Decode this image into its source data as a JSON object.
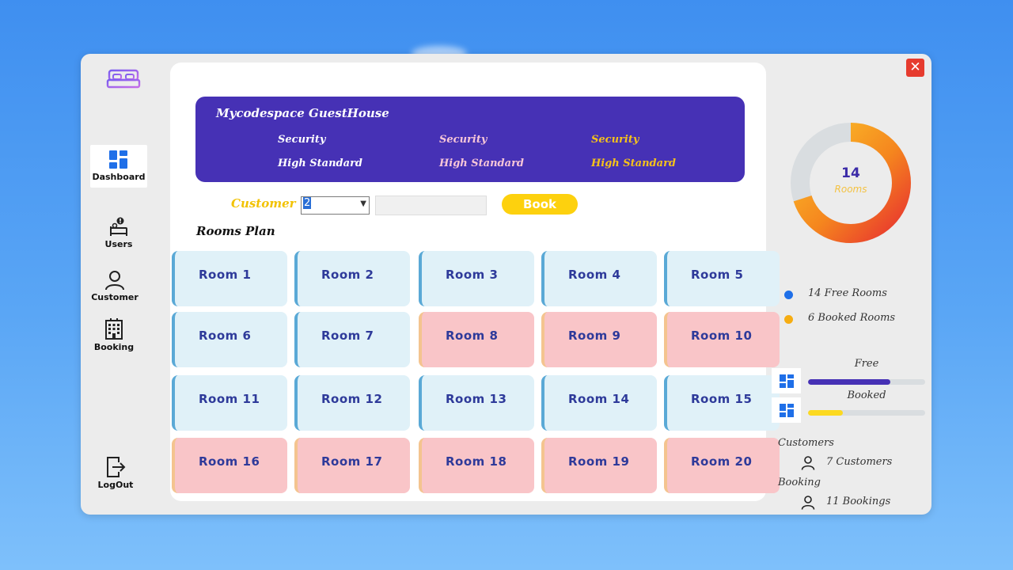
{
  "sidebar": {
    "logo_icon": "bed-icon",
    "items": [
      {
        "label": "Dashboard",
        "icon": "dashboard-icon"
      },
      {
        "label": "Users",
        "icon": "users-icon"
      },
      {
        "label": "Customer",
        "icon": "customer-icon"
      },
      {
        "label": "Booking",
        "icon": "building-icon"
      },
      {
        "label": "LogOut",
        "icon": "logout-icon"
      }
    ]
  },
  "banner": {
    "title": "Mycodespace GuestHouse",
    "columns": [
      {
        "line1": "Security",
        "line2": "High Standard",
        "color": "#ffffff"
      },
      {
        "line1": "Security",
        "line2": "High Standard",
        "color": "#f7c6d8"
      },
      {
        "line1": "Security",
        "line2": "High Standard",
        "color": "#f6c21a"
      }
    ]
  },
  "booking_form": {
    "customer_label": "Customer",
    "customer_value": "2",
    "book_label": "Book"
  },
  "rooms_plan": {
    "title": "Rooms Plan",
    "rooms": [
      {
        "name": "Room 1",
        "status": "free"
      },
      {
        "name": "Room 2",
        "status": "free"
      },
      {
        "name": "Room 3",
        "status": "free"
      },
      {
        "name": "Room 4",
        "status": "free"
      },
      {
        "name": "Room 5",
        "status": "free"
      },
      {
        "name": "Room 6",
        "status": "free"
      },
      {
        "name": "Room 7",
        "status": "free"
      },
      {
        "name": "Room 8",
        "status": "booked"
      },
      {
        "name": "Room 9",
        "status": "booked"
      },
      {
        "name": "Room 10",
        "status": "booked"
      },
      {
        "name": "Room 11",
        "status": "free"
      },
      {
        "name": "Room 12",
        "status": "free"
      },
      {
        "name": "Room 13",
        "status": "free"
      },
      {
        "name": "Room 14",
        "status": "free"
      },
      {
        "name": "Room 15",
        "status": "free"
      },
      {
        "name": "Room 16",
        "status": "booked"
      },
      {
        "name": "Room 17",
        "status": "booked"
      },
      {
        "name": "Room 18",
        "status": "booked"
      },
      {
        "name": "Room 19",
        "status": "booked"
      },
      {
        "name": "Room 20",
        "status": "booked"
      }
    ]
  },
  "summary": {
    "donut": {
      "number": "14",
      "label": "Rooms",
      "free": 14,
      "booked": 6
    },
    "legend": [
      {
        "text": "14 Free Rooms",
        "color": "#1f6fe8"
      },
      {
        "text": "6 Booked Rooms",
        "color": "#f6ad12"
      }
    ],
    "bars": [
      {
        "label": "Free",
        "fraction": 0.7,
        "color": "#4631b5"
      },
      {
        "label": "Booked",
        "fraction": 0.3,
        "color": "#fcd920"
      }
    ],
    "customers_label": "Customers",
    "customers_value": "7 Customers",
    "booking_label": "Booking",
    "booking_value": "11 Bookings"
  },
  "window": {
    "close_symbol": "✕"
  }
}
